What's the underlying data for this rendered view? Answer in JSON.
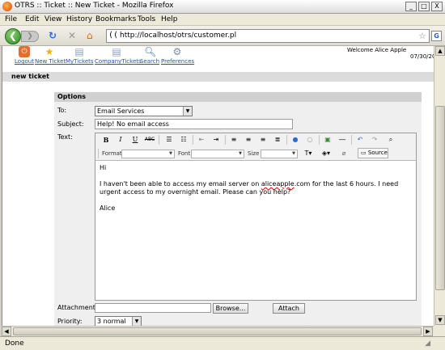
{
  "window": {
    "title": "OTRS :: Ticket :: New Ticket - Mozilla Firefox",
    "controls": [
      "_",
      "□",
      "X"
    ]
  },
  "menu": [
    "File",
    "Edit",
    "View",
    "History",
    "Bookmarks",
    "Tools",
    "Help"
  ],
  "nav": {
    "back": "❮",
    "forward": "❯",
    "url": "http://localhost/otrs/customer.pl",
    "identity": "((",
    "search_engine": "G"
  },
  "otrs": {
    "nav_items": [
      {
        "label": "Logout",
        "icon": "logout-icon"
      },
      {
        "label": "New Ticket",
        "icon": "new-ticket-icon"
      },
      {
        "label": "MyTickets",
        "icon": "my-tickets-icon"
      },
      {
        "label": "CompanyTickets",
        "icon": "company-tickets-icon"
      },
      {
        "label": "Search",
        "icon": "search-icon"
      },
      {
        "label": "Preferences",
        "icon": "preferences-icon"
      }
    ],
    "welcome": "Welcome Alice Apple",
    "date": "07/30/20",
    "section_title": "new ticket"
  },
  "form": {
    "options_header": "Options",
    "to_label": "To:",
    "to_value": "Email Services",
    "subject_label": "Subject:",
    "subject_value": "Help! No email access",
    "text_label": "Text:",
    "format_label": "Format",
    "font_label": "Font",
    "size_label": "Size",
    "source_label": "Source",
    "body_lines": [
      "Hi",
      "I haven't been able to access my email server on aliceapple.com for the last 6 hours. I need urgent access to my overnight email. Please can you help?",
      "Alice"
    ],
    "body_pre": "I haven't been able to access my email server on ",
    "body_spell": "aliceapple",
    "body_post": ".com for the last 6 hours. I need urgent access to my overnight email. Please can you help?",
    "attachment_label": "Attachment:",
    "browse_label": "Browse...",
    "attach_label": "Attach",
    "priority_label": "Priority:",
    "priority_value": "3 normal"
  },
  "status": {
    "text": "Done"
  }
}
